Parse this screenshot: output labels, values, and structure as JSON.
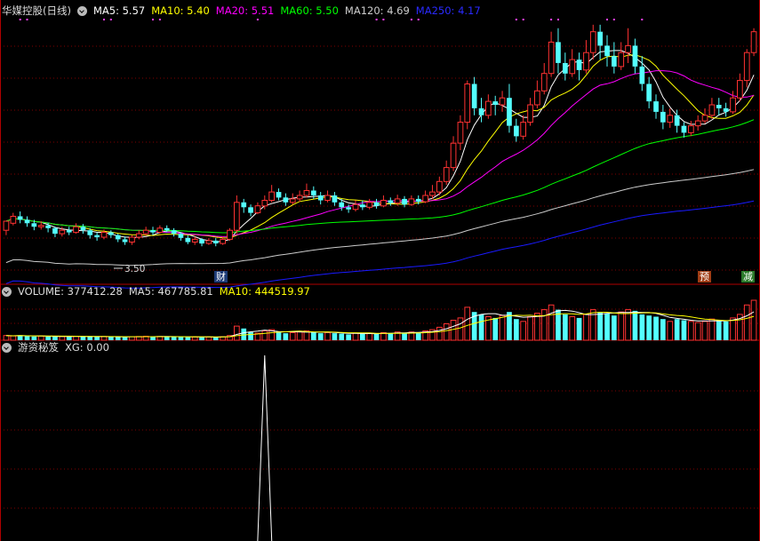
{
  "main_panel": {
    "title": "华媒控股(日线)",
    "ma": [
      {
        "label": "MA5: 5.57",
        "color": "#ffffff"
      },
      {
        "label": "MA10: 5.40",
        "color": "#ffff00"
      },
      {
        "label": "MA20: 5.51",
        "color": "#ff00ff"
      },
      {
        "label": "MA60: 5.50",
        "color": "#00ff00"
      },
      {
        "label": "MA120: 4.69",
        "color": "#cccccc"
      },
      {
        "label": "MA250: 4.17",
        "color": "#0000ff"
      }
    ],
    "low_label": "3.50",
    "badges": {
      "cai": "财",
      "yu": "预",
      "jian": "减"
    }
  },
  "volume_panel": {
    "label_volume": "VOLUME: 377412.28",
    "label_ma5": "MA5: 467785.81",
    "label_ma10": "MA10: 444519.97"
  },
  "indicator_panel": {
    "title": "游资秘笈",
    "label_xg": "XG: 0.00"
  },
  "colors": {
    "up": "#ff3232",
    "down": "#54ffff",
    "grid": "#800000",
    "border": "#b00000"
  },
  "chart_data": {
    "type": "candlestick",
    "price_range": [
      3.3,
      7.1
    ],
    "candles": [
      [
        4.05,
        4.18,
        4.15,
        3.98
      ],
      [
        4.15,
        4.25,
        4.3,
        4.12
      ],
      [
        4.25,
        4.2,
        4.32,
        4.15
      ],
      [
        4.2,
        4.15,
        4.25,
        4.1
      ],
      [
        4.15,
        4.1,
        4.2,
        4.05
      ],
      [
        4.1,
        4.12,
        4.18,
        4.06
      ],
      [
        4.12,
        4.08,
        4.16,
        4.02
      ],
      [
        4.08,
        4.0,
        4.1,
        3.95
      ],
      [
        4.0,
        4.05,
        4.1,
        3.96
      ],
      [
        4.05,
        4.02,
        4.1,
        3.98
      ],
      [
        4.02,
        4.1,
        4.15,
        4.0
      ],
      [
        4.1,
        4.05,
        4.14,
        4.0
      ],
      [
        4.05,
        3.98,
        4.08,
        3.93
      ],
      [
        3.98,
        3.95,
        4.02,
        3.9
      ],
      [
        3.95,
        4.02,
        4.06,
        3.92
      ],
      [
        4.02,
        3.98,
        4.05,
        3.94
      ],
      [
        3.98,
        3.92,
        4.0,
        3.88
      ],
      [
        3.92,
        3.88,
        3.96,
        3.84
      ],
      [
        3.88,
        3.95,
        3.98,
        3.84
      ],
      [
        3.95,
        4.0,
        4.05,
        3.92
      ],
      [
        4.0,
        4.05,
        4.1,
        3.97
      ],
      [
        4.05,
        4.02,
        4.1,
        3.98
      ],
      [
        4.02,
        4.08,
        4.12,
        4.0
      ],
      [
        4.08,
        4.05,
        4.12,
        4.02
      ],
      [
        4.05,
        4.0,
        4.08,
        3.96
      ],
      [
        4.0,
        3.94,
        4.02,
        3.9
      ],
      [
        3.94,
        3.88,
        3.98,
        3.85
      ],
      [
        3.88,
        3.92,
        3.96,
        3.84
      ],
      [
        3.92,
        3.86,
        3.94,
        3.82
      ],
      [
        3.86,
        3.9,
        3.94,
        3.84
      ],
      [
        3.9,
        3.86,
        3.94,
        3.82
      ],
      [
        3.86,
        3.92,
        3.96,
        3.84
      ],
      [
        3.92,
        4.05,
        4.08,
        3.9
      ],
      [
        4.05,
        4.45,
        4.55,
        4.0
      ],
      [
        4.45,
        4.38,
        4.5,
        4.3
      ],
      [
        4.38,
        4.3,
        4.42,
        4.25
      ],
      [
        4.3,
        4.4,
        4.45,
        4.28
      ],
      [
        4.4,
        4.48,
        4.55,
        4.35
      ],
      [
        4.48,
        4.6,
        4.7,
        4.45
      ],
      [
        4.6,
        4.52,
        4.65,
        4.48
      ],
      [
        4.52,
        4.45,
        4.58,
        4.4
      ],
      [
        4.45,
        4.5,
        4.58,
        4.42
      ],
      [
        4.5,
        4.55,
        4.62,
        4.46
      ],
      [
        4.55,
        4.62,
        4.72,
        4.52
      ],
      [
        4.62,
        4.55,
        4.68,
        4.5
      ],
      [
        4.55,
        4.48,
        4.6,
        4.42
      ],
      [
        4.48,
        4.55,
        4.62,
        4.45
      ],
      [
        4.55,
        4.45,
        4.6,
        4.4
      ],
      [
        4.45,
        4.38,
        4.5,
        4.33
      ],
      [
        4.38,
        4.35,
        4.42,
        4.3
      ],
      [
        4.35,
        4.42,
        4.48,
        4.32
      ],
      [
        4.42,
        4.38,
        4.48,
        4.34
      ],
      [
        4.38,
        4.45,
        4.5,
        4.35
      ],
      [
        4.45,
        4.4,
        4.5,
        4.36
      ],
      [
        4.4,
        4.48,
        4.55,
        4.38
      ],
      [
        4.48,
        4.44,
        4.52,
        4.4
      ],
      [
        4.44,
        4.5,
        4.56,
        4.4
      ],
      [
        4.5,
        4.42,
        4.54,
        4.38
      ],
      [
        4.42,
        4.5,
        4.55,
        4.4
      ],
      [
        4.5,
        4.46,
        4.55,
        4.42
      ],
      [
        4.46,
        4.55,
        4.62,
        4.44
      ],
      [
        4.55,
        4.6,
        4.7,
        4.5
      ],
      [
        4.6,
        4.75,
        4.82,
        4.55
      ],
      [
        4.75,
        4.95,
        5.05,
        4.7
      ],
      [
        4.95,
        5.3,
        5.4,
        4.9
      ],
      [
        5.3,
        5.6,
        5.7,
        5.2
      ],
      [
        5.6,
        6.15,
        6.2,
        5.5
      ],
      [
        6.15,
        5.8,
        6.25,
        5.7
      ],
      [
        5.8,
        5.7,
        5.95,
        5.6
      ],
      [
        5.7,
        5.9,
        6.0,
        5.65
      ],
      [
        5.9,
        5.85,
        5.98,
        5.7
      ],
      [
        5.85,
        5.95,
        6.05,
        5.75
      ],
      [
        5.95,
        5.55,
        6.15,
        5.45
      ],
      [
        5.55,
        5.4,
        5.65,
        5.32
      ],
      [
        5.4,
        5.6,
        5.7,
        5.35
      ],
      [
        5.6,
        5.85,
        5.95,
        5.55
      ],
      [
        5.85,
        6.05,
        6.2,
        5.8
      ],
      [
        6.05,
        6.3,
        6.45,
        6.0
      ],
      [
        6.3,
        6.75,
        6.9,
        6.25
      ],
      [
        6.75,
        6.45,
        6.95,
        6.3
      ],
      [
        6.45,
        6.3,
        6.6,
        6.2
      ],
      [
        6.3,
        6.5,
        6.65,
        6.25
      ],
      [
        6.5,
        6.35,
        6.6,
        6.2
      ],
      [
        6.35,
        6.6,
        6.78,
        6.3
      ],
      [
        6.6,
        6.9,
        7.0,
        6.5
      ],
      [
        6.9,
        6.7,
        7.0,
        6.5
      ],
      [
        6.7,
        6.55,
        6.85,
        6.4
      ],
      [
        6.55,
        6.4,
        6.75,
        6.3
      ],
      [
        6.4,
        6.6,
        6.75,
        6.35
      ],
      [
        6.6,
        6.7,
        6.95,
        6.45
      ],
      [
        6.7,
        6.4,
        6.8,
        6.3
      ],
      [
        6.4,
        6.15,
        6.55,
        6.05
      ],
      [
        6.15,
        5.9,
        6.25,
        5.8
      ],
      [
        5.9,
        5.75,
        6.0,
        5.65
      ],
      [
        5.75,
        5.6,
        5.85,
        5.5
      ],
      [
        5.6,
        5.7,
        5.8,
        5.52
      ],
      [
        5.7,
        5.55,
        5.78,
        5.45
      ],
      [
        5.55,
        5.45,
        5.6,
        5.38
      ],
      [
        5.45,
        5.55,
        5.62,
        5.4
      ],
      [
        5.55,
        5.62,
        5.7,
        5.48
      ],
      [
        5.62,
        5.7,
        5.8,
        5.58
      ],
      [
        5.7,
        5.85,
        5.95,
        5.65
      ],
      [
        5.85,
        5.8,
        5.95,
        5.7
      ],
      [
        5.8,
        5.75,
        5.88,
        5.68
      ],
      [
        5.75,
        5.95,
        6.05,
        5.72
      ],
      [
        5.95,
        6.2,
        6.3,
        5.9
      ],
      [
        6.2,
        6.6,
        6.65,
        6.1
      ],
      [
        6.6,
        6.9,
        6.95,
        6.55
      ]
    ],
    "volumes": [
      2.0,
      1.8,
      2.1,
      1.7,
      1.6,
      1.8,
      1.5,
      1.7,
      1.6,
      1.5,
      1.7,
      1.6,
      1.5,
      1.4,
      1.6,
      1.5,
      1.4,
      1.3,
      1.5,
      1.6,
      1.7,
      1.5,
      1.6,
      1.5,
      1.4,
      1.5,
      1.3,
      1.4,
      1.3,
      1.4,
      1.3,
      1.5,
      2.0,
      6.0,
      5.0,
      3.5,
      3.0,
      4.0,
      4.5,
      3.5,
      3.0,
      3.2,
      3.5,
      4.0,
      3.5,
      3.0,
      3.2,
      3.0,
      2.8,
      2.5,
      3.0,
      2.8,
      3.0,
      2.7,
      3.2,
      3.0,
      3.5,
      3.2,
      3.5,
      3.3,
      4.0,
      4.5,
      5.5,
      7.0,
      8.5,
      9.5,
      14.0,
      12.0,
      11.0,
      10.0,
      9.5,
      10.5,
      12.0,
      9.0,
      8.0,
      10.0,
      11.5,
      13.0,
      15.0,
      13.0,
      11.0,
      10.0,
      9.5,
      11.0,
      13.0,
      12.0,
      11.5,
      10.5,
      12.0,
      13.0,
      12.5,
      11.0,
      10.5,
      10.0,
      9.0,
      8.0,
      9.0,
      8.5,
      8.0,
      7.5,
      8.0,
      9.0,
      8.5,
      8.0,
      9.5,
      11.0,
      15.0,
      17.0
    ],
    "indicator_spike_index": 37
  }
}
